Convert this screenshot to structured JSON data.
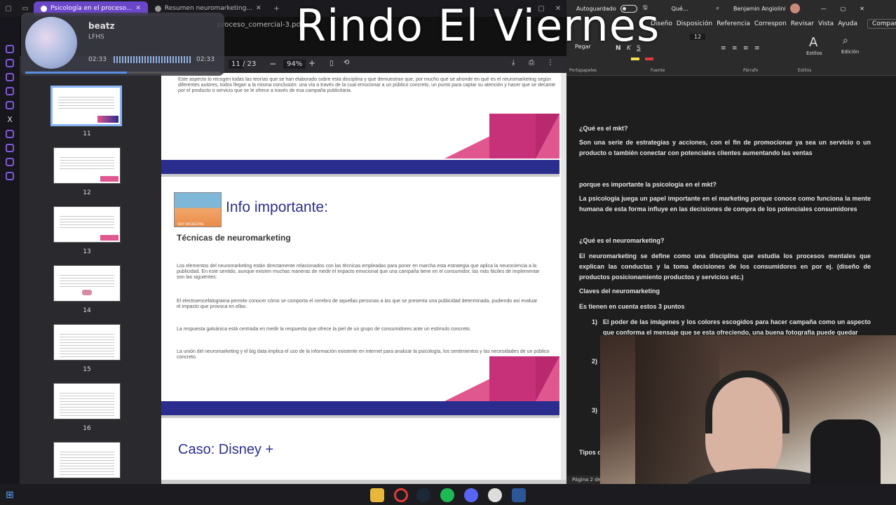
{
  "overlay": {
    "title": "Rindo El Viernes"
  },
  "browser": {
    "tabs": [
      {
        "label": "Psicología en el proceso..."
      },
      {
        "label": "Resumen neuromarketing..."
      }
    ],
    "new_tab": "+"
  },
  "music": {
    "title": "beatz",
    "artist": "LFHS",
    "elapsed": "02:33",
    "total": "02:33",
    "progress": 0.52
  },
  "pdf": {
    "filename": "proceso_comercial-3.pdf",
    "page_current": "11",
    "page_total": "/ 23",
    "zoom": "94%",
    "zoom_out": "−",
    "zoom_in": "+",
    "thumb_labels": [
      "11",
      "12",
      "13",
      "14",
      "15",
      "16"
    ],
    "page": {
      "top_text": "Este aspecto lo recogen todas las teorías que se han elaborado sobre esta disciplina y que demuestran que, por mucho que se ahonde en qué es el neuromarketing según diferentes autores, todos llegan a la misma conclusión: una vía a través de la cual emocionar a un público concreto, un punto para captar su atención y hacer que se decante por el producto o servicio que se le ofrece a través de esa campaña publicitaria.",
      "heading": "Info importante:",
      "subheading": "Técnicas de neuromarketing",
      "para1": "Los elementos del neuromarketing están directamente relacionados con las técnicas empleadas para poner en marcha esta estrategia que aplica la neurociencia a la publicidad. En este sentido, aunque existen muchas maneras de medir el impacto emocional que una campaña tiene en el consumidor, las más fáciles de implementar son las siguientes:",
      "para2": "El electroencefalograma permite conocer cómo se comporta el cerebro de aquellas personas a las que se presenta una publicidad determinada, pudiendo así evaluar el impacto que provoca en ellas.",
      "para3": "La respuesta galvánica está centrada en medir la respuesta que ofrece la piel de un grupo de consumidores ante un estímulo concreto.",
      "para4": "La unión del neuromarketing y el big data implica el uso de la información existente en internet para analizar la psicología, los sentimientos y las necesidades de un público concreto.",
      "case_heading": "Caso: Disney +",
      "image_caption": "VERY INTERESTING"
    }
  },
  "word": {
    "autosave": "Autoguardado",
    "doc_title": "Qué...",
    "user": "Benjamin Angiolini",
    "menu": [
      "Diseño",
      "Disposición",
      "Referencia",
      "Correspon",
      "Revisar",
      "Vista",
      "Ayuda"
    ],
    "share": "Compartir",
    "ribbon": {
      "paste": "Pegar",
      "styles": "Estilos",
      "edit": "Edición",
      "font_size": "12",
      "clipboard": "Portapapeles",
      "font": "Fuente",
      "paragraph": "Párrafo",
      "styles_group": "Estilos"
    },
    "doc": {
      "q1": "¿Qué es el mkt?",
      "a1": "Son una serie de estrategias y acciones, con el fin de promocionar ya sea un servicio o un producto o también conectar con potenciales clientes aumentando las ventas",
      "q2": "porque es importante la psicología en el mkt?",
      "a2": "La psicología juega un papel importante en el marketing porque conoce como funciona la mente humana de esta forma influye en las decisiones de compra de los potenciales consumidores",
      "q3": "¿Qué es el neuromarketing?",
      "a3": "El neuromarketing se define como una disciplina que estudia los procesos mentales que explican las conductas y la toma decisiones de los consumidores en por ej. (diseño de productos posicionamiento productos y servicios etc.)",
      "h4": "Claves del neuromarketing",
      "p4": "Es tienen en cuenta estos 3 puntos",
      "li1_num": "1)",
      "li1": "El poder de las imágenes y los colores escogidos para hacer campaña como un aspecto que conforma el mensaje que se esta ofreciendo, una buena fotografía puede quedar",
      "li2_num": "2)",
      "li3_num": "3)",
      "tail": "Tipos d"
    },
    "status": "Página 2 de"
  }
}
